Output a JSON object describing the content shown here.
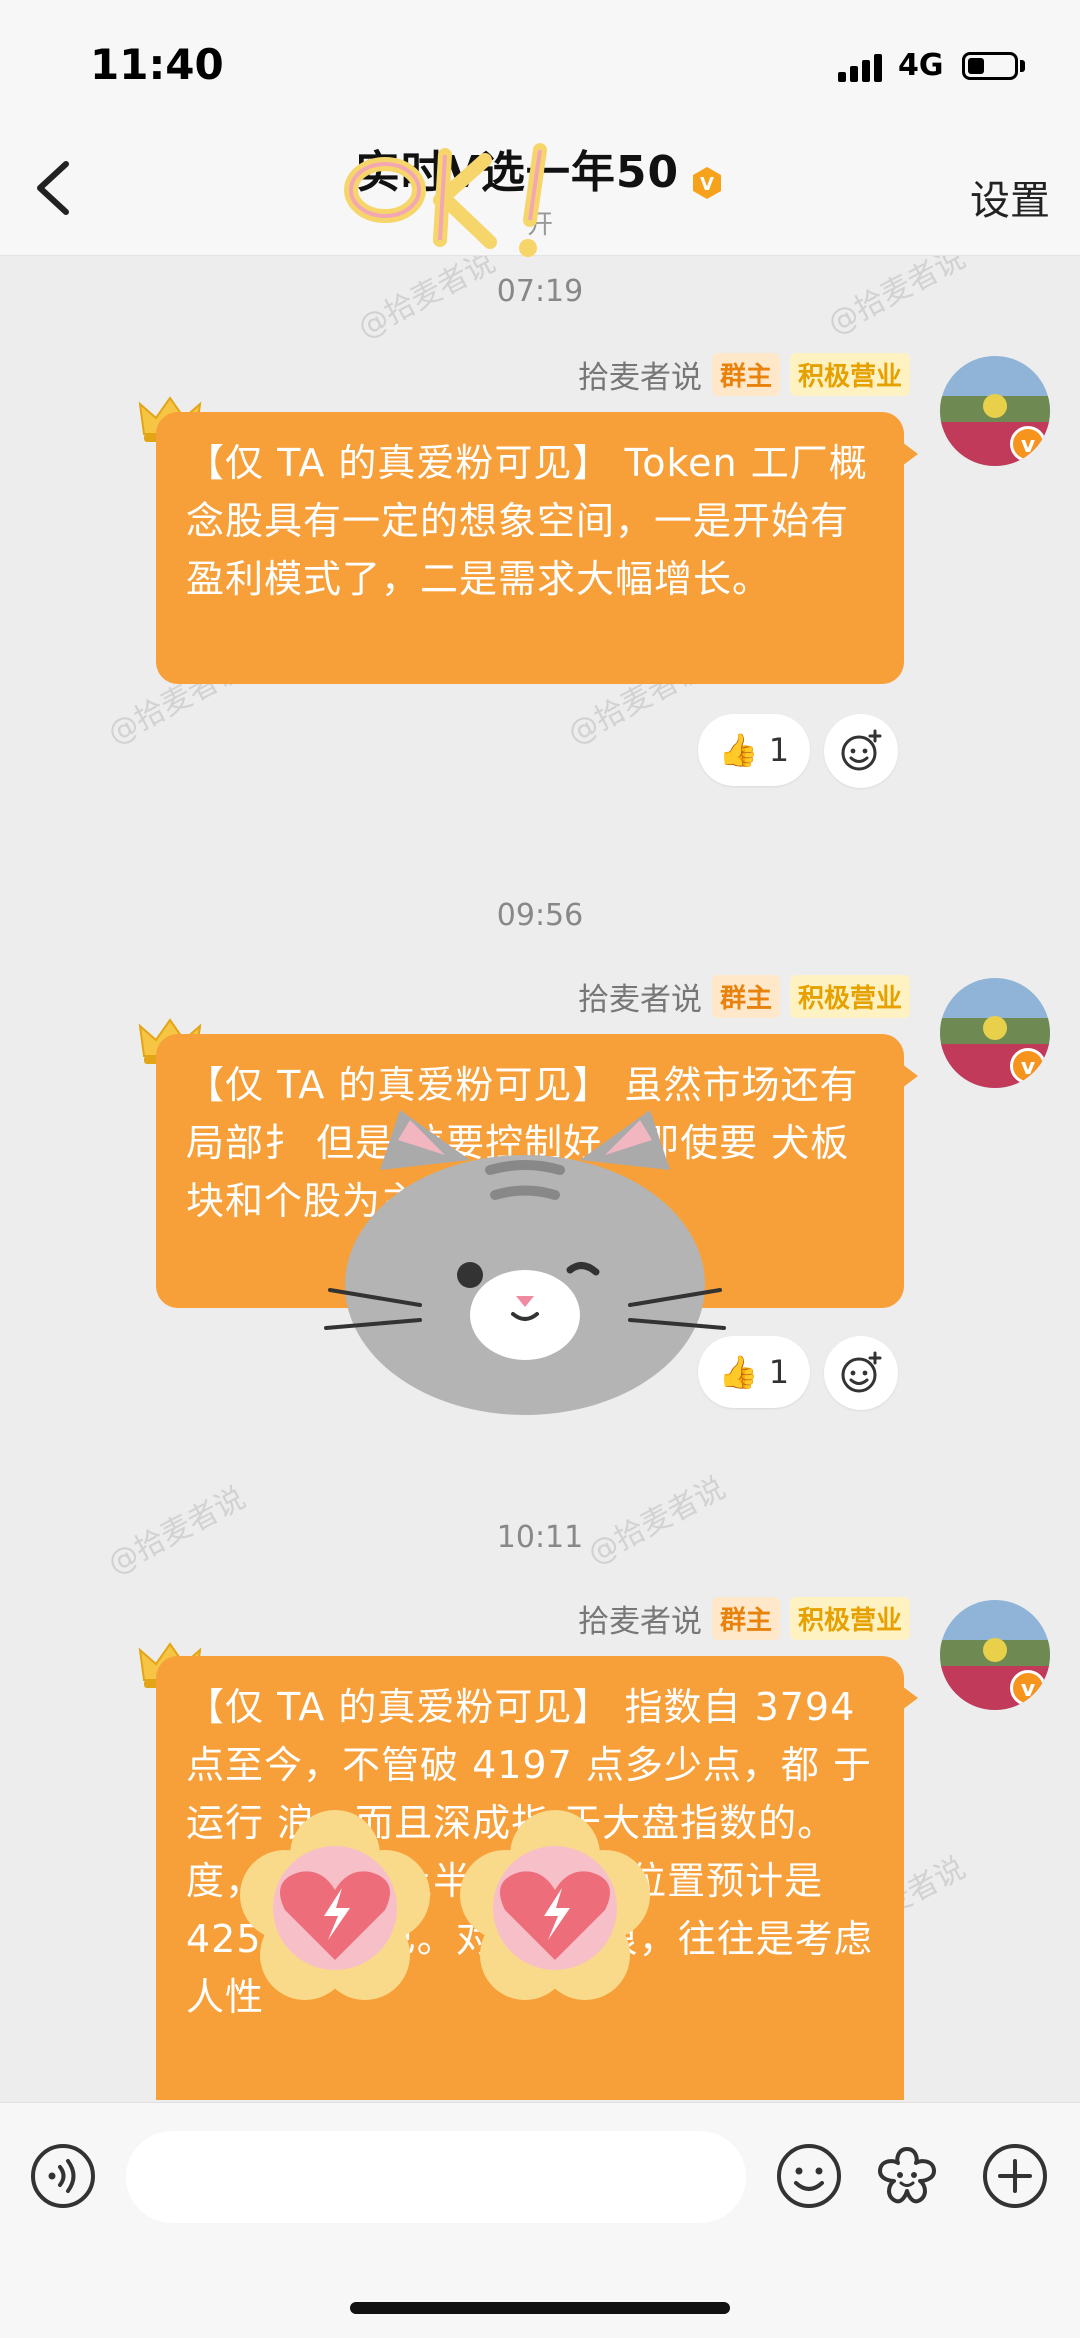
{
  "status_bar": {
    "time": "11:40",
    "network": "4G"
  },
  "nav": {
    "title": "实时V选一年50",
    "subtitle": "开",
    "settings_label": "设置"
  },
  "messages": [
    {
      "timestamp": "07:19",
      "sender": "拾麦者说",
      "tags": [
        "群主",
        "积极营业"
      ],
      "text": "【仅 TA 的真爱粉可见】 Token 工厂概念股具有一定的想象空间，一是开始有盈利模式了，二是需求大幅增长。",
      "likes": "1"
    },
    {
      "timestamp": "09:56",
      "sender": "拾麦者说",
      "tags": [
        "群主",
        "积极营业"
      ],
      "text": "【仅 TA 的真爱粉可见】 虽然市场还有局部扌 但是 位要控制好，即使要 犬板块和个股为主。",
      "likes": "1"
    },
    {
      "timestamp": "10:11",
      "sender": "拾麦者说",
      "tags": [
        "群主",
        "积极营业"
      ],
      "text": "【仅 TA 的真爱粉可见】 指数自 3794 点至今，不管破 4197 点多少点，都 于运行 浪。而且深成指 于大盘指数的。 度， 断今年上半年的最高位置预计是 4256 点而已。对于第Ⅴ浪，往往是考虑人性"
    }
  ],
  "watermark": "@拾麦者说",
  "input": {
    "placeholder": ""
  },
  "colors": {
    "bubble": "#f7a03a",
    "accent": "#f7941d",
    "background": "#ededed"
  }
}
